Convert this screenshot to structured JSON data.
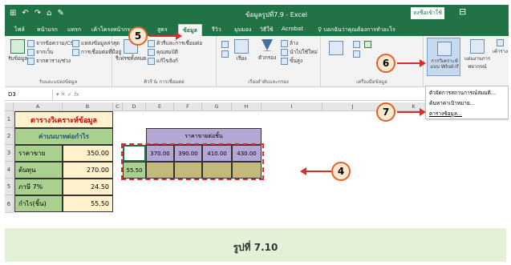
{
  "titlebar": {
    "document_title": "ข้อมูลรูปที่7.9 - Excel",
    "signin_label": "ลงชื่อเข้าใช้",
    "qat": [
      "⊞",
      "↶",
      "↷",
      "⌂",
      "✎"
    ]
  },
  "tabs": [
    "ไฟล์",
    "หน้าแรก",
    "แทรก",
    "เค้าโครงหน้ากระดาษ",
    "สูตร",
    "ข้อมูล",
    "รีวิว",
    "มุมมอง",
    "วิธีใช้",
    "Acrobat",
    "บอกฉันว่าคุณต้องการทำอะไร"
  ],
  "ribbon": {
    "get_data": {
      "label": "รับข้อมูล",
      "items": [
        "จากข้อความ/CSV",
        "จากเว็บ",
        "จากตาราง/ช่วง",
        "แหล่งข้อมูลล่าสุด",
        "การเชื่อมต่อที่มีอยู่"
      ],
      "group_label": "รับและแปลงข้อมูล"
    },
    "queries": {
      "items": [
        "คิวรีและการเชื่อมต่อ",
        "คุณสมบัติ",
        "แก้ไขลิงก์"
      ],
      "refresh_label": "รีเฟรชทั้งหมด",
      "group_label": "คิวรี & การเชื่อมต่อ"
    },
    "sort_filter": {
      "items": [
        "เรียง",
        "ตัวกรอง",
        "ล้าง",
        "นำไปใช้ใหม่",
        "ขั้นสูง"
      ],
      "group_label": "เรียงลำดับและกรอง"
    },
    "data_tools": {
      "group_label": "เครื่องมือข้อมูล"
    },
    "forecast": {
      "whatif_label": "การวิเคราะห์แบบ What-If",
      "forecast_label": "แผ่นงานการพยากรณ์",
      "outline_label": "เค้าร่าง"
    }
  },
  "dropdown": [
    "ตัวจัดการสถานการณ์สมมติ...",
    "ค้นหาค่าเป้าหมาย...",
    "ตารางข้อมูล..."
  ],
  "formula_bar": {
    "namebox": "D3",
    "fx_symbol": "fx"
  },
  "columns": [
    "A",
    "B",
    "C",
    "D",
    "E",
    "F",
    "G",
    "H",
    "I",
    "J",
    "K",
    "L"
  ],
  "rows": [
    "1",
    "2",
    "3",
    "4",
    "5",
    "6"
  ],
  "sheet": {
    "a1": "ตารางวิเคราะห์ข้อมูล",
    "a2": "ค่าบนบาทต่อกำไร",
    "labels": [
      "ราคาขาย",
      "ต้นทุน",
      "ภาษี 7%",
      "กำไร(ชิ้น)"
    ],
    "values": [
      "350.00",
      "270.00",
      "24.50",
      "55.50"
    ],
    "e2_header": "ราคาขายต่อชิ้น",
    "prices": [
      "370.00",
      "390.00",
      "410.00",
      "430.00"
    ],
    "d4": "55.50"
  },
  "callouts": [
    "5",
    "6",
    "7",
    "4"
  ],
  "caption": "รูปที่ 7.10",
  "colors": {
    "excel_green": "#217346",
    "callout_border": "#e2602a",
    "dashed_red": "#e02b2b",
    "caption_bg": "#e3f1d7"
  }
}
